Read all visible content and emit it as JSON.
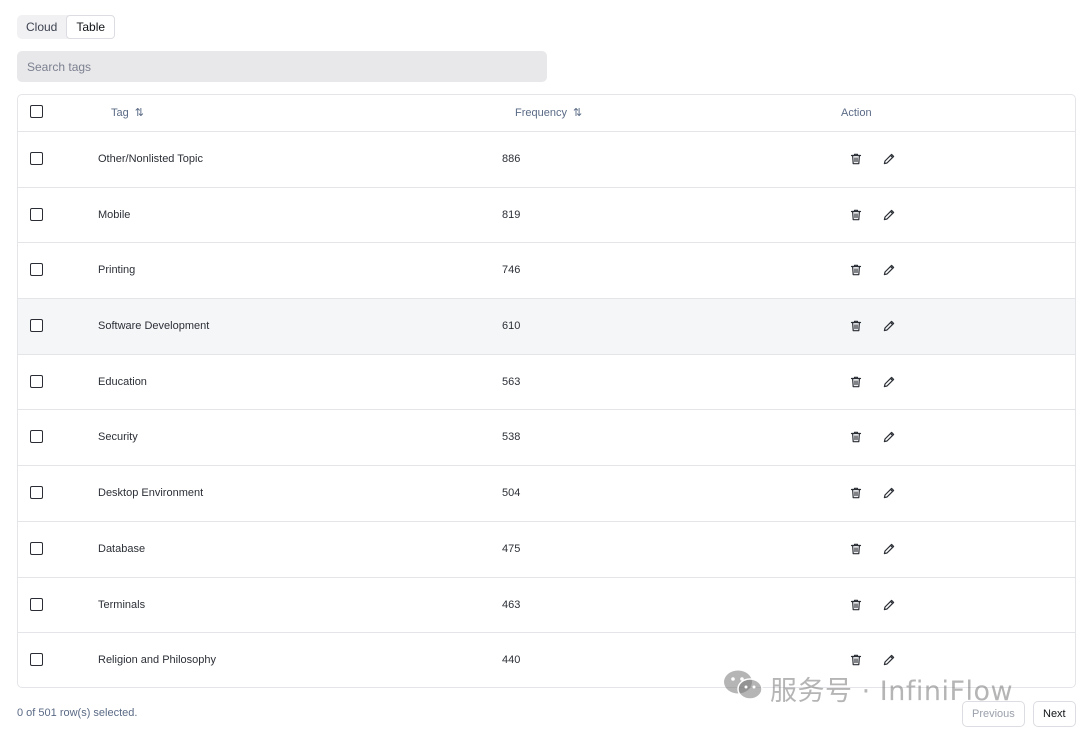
{
  "view_toggle": {
    "options": [
      "Cloud",
      "Table"
    ],
    "selected": "Table"
  },
  "search": {
    "placeholder": "Search tags",
    "value": ""
  },
  "table": {
    "columns": {
      "tag": "Tag",
      "frequency": "Frequency",
      "action": "Action"
    },
    "sort_icon": "⇅",
    "rows": [
      {
        "tag": "Other/Nonlisted Topic",
        "frequency": "886"
      },
      {
        "tag": "Mobile",
        "frequency": "819"
      },
      {
        "tag": "Printing",
        "frequency": "746"
      },
      {
        "tag": "Software Development",
        "frequency": "610"
      },
      {
        "tag": "Education",
        "frequency": "563"
      },
      {
        "tag": "Security",
        "frequency": "538"
      },
      {
        "tag": "Desktop Environment",
        "frequency": "504"
      },
      {
        "tag": "Database",
        "frequency": "475"
      },
      {
        "tag": "Terminals",
        "frequency": "463"
      },
      {
        "tag": "Religion and Philosophy",
        "frequency": "440"
      }
    ],
    "highlighted_row": 3,
    "row_icons": [
      "trash-icon",
      "pencil-icon"
    ]
  },
  "footer": {
    "selection_status": "0 of 501 row(s) selected.",
    "previous_label": "Previous",
    "next_label": "Next"
  },
  "watermark": {
    "text": "服务号 · InfiniFlow",
    "icon": "wechat-icon"
  }
}
